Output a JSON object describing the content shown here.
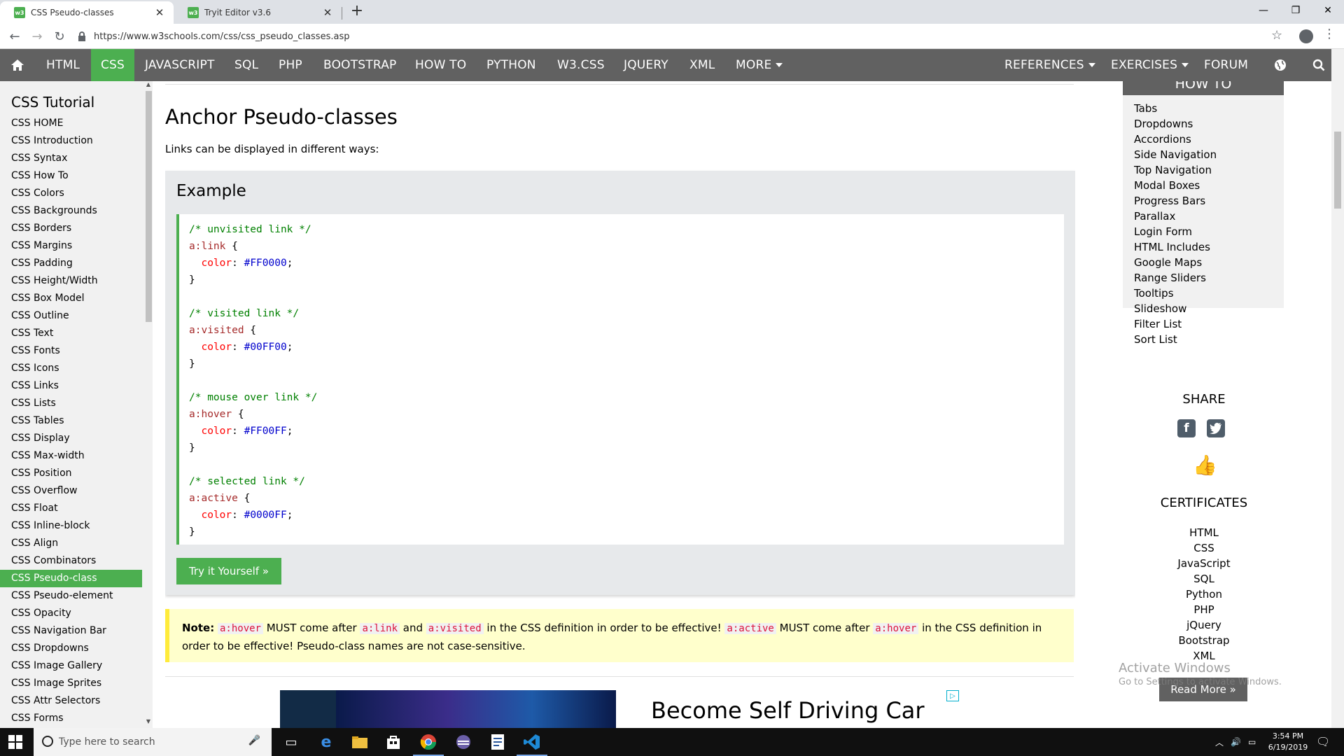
{
  "browser": {
    "tabs": [
      {
        "title": "CSS Pseudo-classes",
        "favicon": "w3",
        "active": true
      },
      {
        "title": "Tryit Editor v3.6",
        "favicon": "w3",
        "active": false
      }
    ],
    "url": "https://www.w3schools.com/css/css_pseudo_classes.asp"
  },
  "topnav": {
    "items": [
      "HTML",
      "CSS",
      "JAVASCRIPT",
      "SQL",
      "PHP",
      "BOOTSTRAP",
      "HOW TO",
      "PYTHON",
      "W3.CSS",
      "JQUERY",
      "XML",
      "MORE"
    ],
    "right_items": [
      "REFERENCES",
      "EXERCISES",
      "FORUM"
    ],
    "active": "CSS",
    "active_color": "#4CAF50",
    "bg_color": "#616161"
  },
  "sidebar": {
    "title": "CSS Tutorial",
    "items": [
      "CSS HOME",
      "CSS Introduction",
      "CSS Syntax",
      "CSS How To",
      "CSS Colors",
      "CSS Backgrounds",
      "CSS Borders",
      "CSS Margins",
      "CSS Padding",
      "CSS Height/Width",
      "CSS Box Model",
      "CSS Outline",
      "CSS Text",
      "CSS Fonts",
      "CSS Icons",
      "CSS Links",
      "CSS Lists",
      "CSS Tables",
      "CSS Display",
      "CSS Max-width",
      "CSS Position",
      "CSS Overflow",
      "CSS Float",
      "CSS Inline-block",
      "CSS Align",
      "CSS Combinators",
      "CSS Pseudo-class",
      "CSS Pseudo-element",
      "CSS Opacity",
      "CSS Navigation Bar",
      "CSS Dropdowns",
      "CSS Image Gallery",
      "CSS Image Sprites",
      "CSS Attr Selectors",
      "CSS Forms"
    ],
    "active": "CSS Pseudo-class"
  },
  "main": {
    "title": "Anchor Pseudo-classes",
    "intro": "Links can be displayed in different ways:",
    "example": {
      "heading": "Example",
      "blocks": [
        {
          "comment": "/* unvisited link */",
          "selector": "a:link",
          "prop": "color",
          "value": "#FF0000"
        },
        {
          "comment": "/* visited link */",
          "selector": "a:visited",
          "prop": "color",
          "value": "#00FF00"
        },
        {
          "comment": "/* mouse over link */",
          "selector": "a:hover",
          "prop": "color",
          "value": "#FF00FF"
        },
        {
          "comment": "/* selected link */",
          "selector": "a:active",
          "prop": "color",
          "value": "#0000FF"
        }
      ],
      "try_button": "Try it Yourself »"
    },
    "note": {
      "label": "Note:",
      "k1": "a:hover",
      "t1": " MUST come after ",
      "k2": "a:link",
      "t2": " and ",
      "k3": "a:visited",
      "t3": " in the CSS definition in order to be effective! ",
      "k4": "a:active",
      "t4": " MUST come after ",
      "k5": "a:hover",
      "t5": " in the CSS definition in order to be effective! Pseudo-class names are not case-sensitive."
    },
    "ad": {
      "text": "Become Self Driving Car"
    }
  },
  "right": {
    "howto_title": "HOW TO",
    "howto_items": [
      "Tabs",
      "Dropdowns",
      "Accordions",
      "Side Navigation",
      "Top Navigation",
      "Modal Boxes",
      "Progress Bars",
      "Parallax",
      "Login Form",
      "HTML Includes",
      "Google Maps",
      "Range Sliders",
      "Tooltips",
      "Slideshow",
      "Filter List",
      "Sort List"
    ],
    "share_title": "SHARE",
    "cert_title": "CERTIFICATES",
    "cert_items": [
      "HTML",
      "CSS",
      "JavaScript",
      "SQL",
      "Python",
      "PHP",
      "jQuery",
      "Bootstrap",
      "XML"
    ],
    "read_more": "Read More »"
  },
  "watermark": {
    "line1": "Activate Windows",
    "line2": "Go to Settings to activate Windows."
  },
  "taskbar": {
    "search_placeholder": "Type here to search",
    "time": "3:54 PM",
    "date": "6/19/2019"
  }
}
